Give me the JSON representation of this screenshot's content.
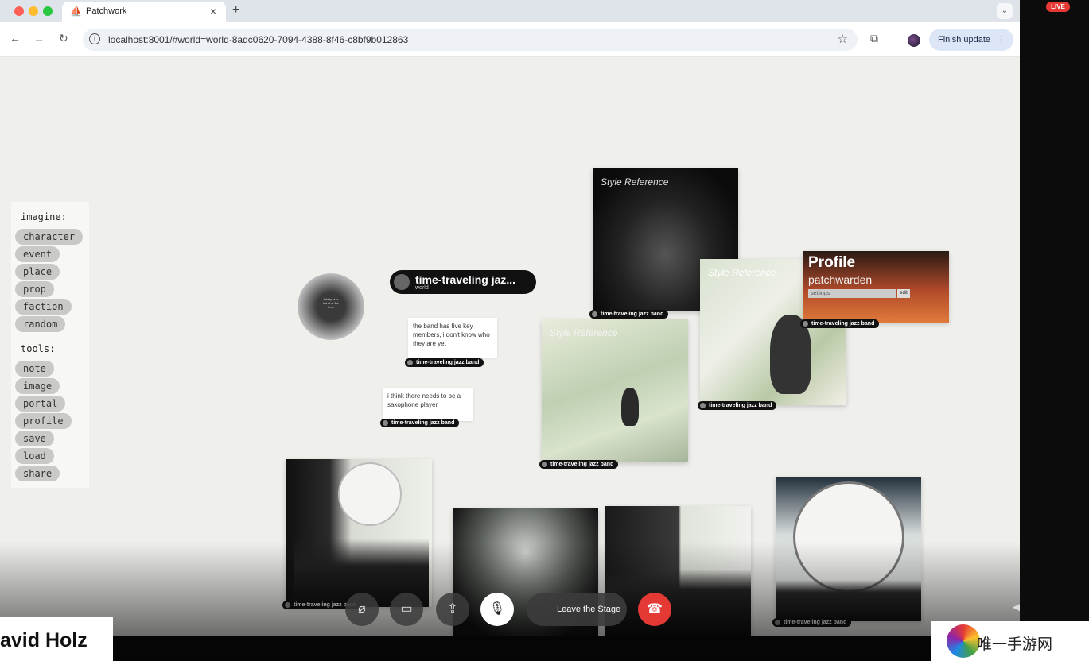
{
  "browser": {
    "tab_title": "Patchwork",
    "tab_close": "×",
    "new_tab": "+",
    "url": "localhost:8001/#world=world-8adc0620-7094-4388-8f46-c8bf9b012863",
    "finish_update": "Finish update",
    "tab_menu_glyph": "⌄"
  },
  "sidebar_panel": {
    "imagine_heading": "imagine:",
    "imagine_items": [
      "character",
      "event",
      "place",
      "prop",
      "faction",
      "random"
    ],
    "tools_heading": "tools:",
    "tools_items": [
      "note",
      "image",
      "portal",
      "profile",
      "save",
      "load",
      "share"
    ]
  },
  "world_pill": {
    "title": "time-traveling jaz...",
    "subtitle": "world"
  },
  "portal_thumb_text": "totally jazz band of the time",
  "notes": [
    {
      "text": "the band has five key members, i don't know who they are yet",
      "caption": "time-traveling jazz band"
    },
    {
      "text": "i think there needs to be a saxophone player",
      "caption": "time-traveling jazz band"
    }
  ],
  "style_reference_label": "Style Reference",
  "image_caption": "time-traveling jazz band",
  "profile_card": {
    "heading": "Profile",
    "name": "patchwarden",
    "input_value": "settings",
    "edit_label": "edit",
    "caption": "time-traveling jazz band"
  },
  "meeting": {
    "leave_stage": "Leave the Stage",
    "live_badge": "LIVE",
    "presenter_name": "avid Holz",
    "watermark_text": "唯一手游网"
  },
  "icons": {
    "back": "back-arrow-icon",
    "forward": "forward-arrow-icon",
    "reload": "reload-icon",
    "star": "bookmark-star-icon",
    "extensions": "puzzle-icon"
  }
}
